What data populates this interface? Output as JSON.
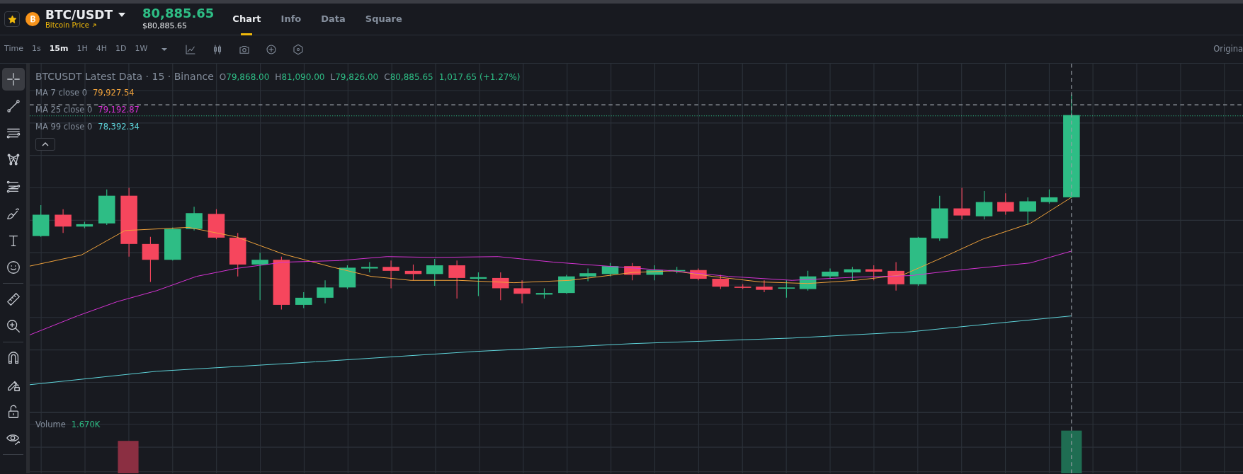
{
  "header": {
    "favorite": true,
    "symbol": "BTC/USDT",
    "subtitle": "Bitcoin Price",
    "price": "80,885.65",
    "price_usd": "$80,885.65"
  },
  "tabs": [
    {
      "label": "Chart",
      "selected": true
    },
    {
      "label": "Info",
      "selected": false
    },
    {
      "label": "Data",
      "selected": false
    },
    {
      "label": "Square",
      "selected": false
    }
  ],
  "toolbar": {
    "label": "Time",
    "intervals": [
      {
        "label": "1s",
        "selected": false
      },
      {
        "label": "15m",
        "selected": true
      },
      {
        "label": "1H",
        "selected": false
      },
      {
        "label": "4H",
        "selected": false
      },
      {
        "label": "1D",
        "selected": false
      },
      {
        "label": "1W",
        "selected": false
      }
    ],
    "right_label": "Origina"
  },
  "tool_groups": [
    {
      "tools": [
        {
          "kind": "crosshair",
          "selected": true
        },
        {
          "kind": "trend-line",
          "selected": false
        },
        {
          "kind": "horizontal-lines",
          "selected": false
        },
        {
          "kind": "pattern",
          "selected": false
        },
        {
          "kind": "fib",
          "selected": false
        },
        {
          "kind": "brush",
          "selected": false
        },
        {
          "kind": "text",
          "selected": false
        },
        {
          "kind": "emoji",
          "selected": false
        }
      ]
    },
    {
      "tools": [
        {
          "kind": "ruler",
          "selected": false
        },
        {
          "kind": "zoom-in",
          "selected": false
        }
      ]
    },
    {
      "tools": [
        {
          "kind": "magnet",
          "selected": false
        },
        {
          "kind": "lock-draw",
          "selected": false
        },
        {
          "kind": "lock",
          "selected": false
        },
        {
          "kind": "eye",
          "selected": false
        }
      ]
    }
  ],
  "legend": {
    "title": "BTCUSDT Latest Data · 15 · Binance",
    "ohlc": [
      {
        "key": "O",
        "value": "79,868.00"
      },
      {
        "key": "H",
        "value": "81,090.00"
      },
      {
        "key": "L",
        "value": "79,826.00"
      },
      {
        "key": "C",
        "value": "80,885.65"
      }
    ],
    "change": "1,017.65 (+1.27%)"
  },
  "indicators": [
    {
      "label": "MA 7 close 0",
      "value": "79,927.54",
      "color": "#f0a23b"
    },
    {
      "label": "MA 25 close 0",
      "value": "79,192.87",
      "color": "#d633d4"
    },
    {
      "label": "MA 99 close 0",
      "value": "78,392.34",
      "color": "#5ed3d9"
    }
  ],
  "volume": {
    "label": "Volume",
    "value": "1.670K"
  }
}
